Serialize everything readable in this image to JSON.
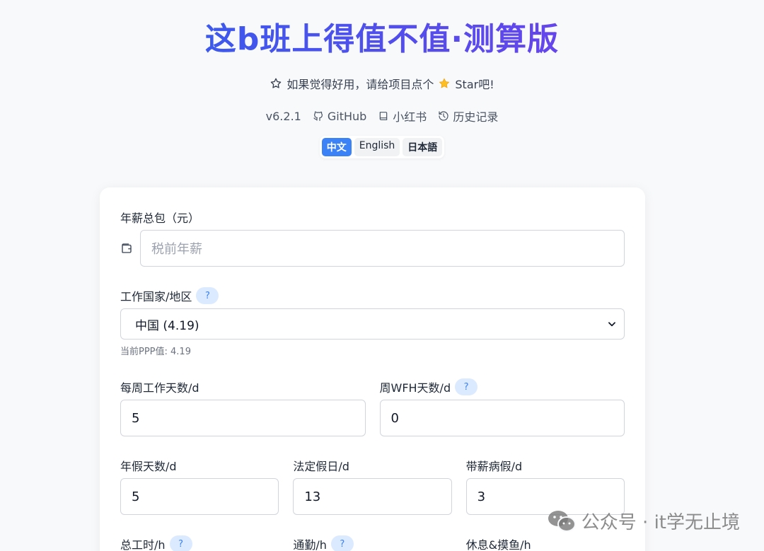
{
  "header": {
    "title": "这b班上得值不值·测算版",
    "star_text": "如果觉得好用，请给项目点个",
    "star_suffix": "Star吧!",
    "version": "v6.2.1",
    "links": [
      "GitHub",
      "小红书",
      "历史记录"
    ],
    "languages": [
      "中文",
      "English",
      "日本語"
    ],
    "active_language": "中文"
  },
  "form": {
    "salary": {
      "label": "年薪总包（元）",
      "placeholder": "税前年薪"
    },
    "country": {
      "label": "工作国家/地区",
      "help": "?",
      "value": "中国 (4.19)",
      "hint": "当前PPP值: 4.19"
    },
    "work_days": {
      "label": "每周工作天数/d",
      "value": "5"
    },
    "wfh_days": {
      "label": "周WFH天数/d",
      "help": "?",
      "value": "0"
    },
    "annual_leave": {
      "label": "年假天数/d",
      "value": "5"
    },
    "holidays": {
      "label": "法定假日/d",
      "value": "13"
    },
    "sick_leave": {
      "label": "带薪病假/d",
      "value": "3"
    },
    "total_hours": {
      "label": "总工时/h",
      "help": "?"
    },
    "commute": {
      "label": "通勤/h",
      "help": "?"
    },
    "rest": {
      "label": "休息&摸鱼/h"
    }
  },
  "watermark": {
    "text": "公众号 · it学无止境"
  }
}
